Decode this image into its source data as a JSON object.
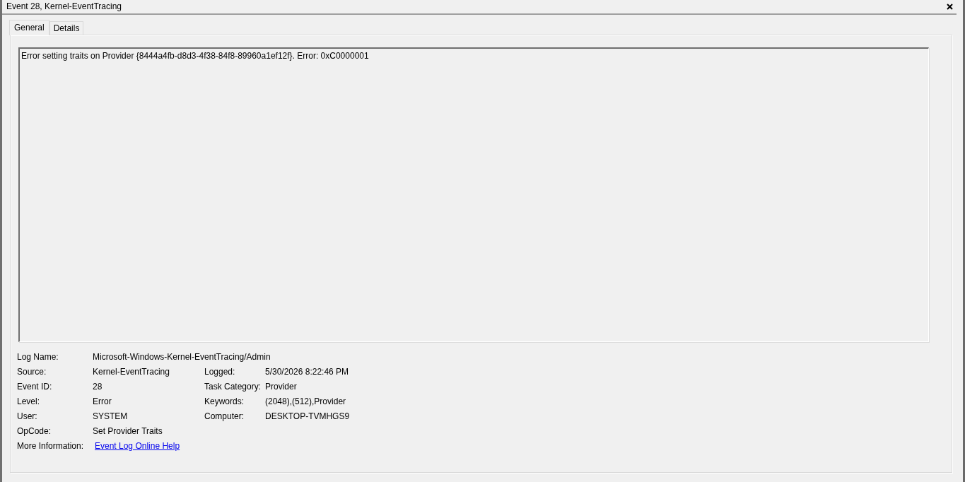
{
  "window": {
    "title": "Event 28, Kernel-EventTracing"
  },
  "tabs": [
    {
      "label": "General",
      "selected": true
    },
    {
      "label": "Details",
      "selected": false
    }
  ],
  "description": "Error setting traits on Provider {8444a4fb-d8d3-4f38-84f8-89960a1ef12f}. Error: 0xC0000001",
  "fields": [
    [
      {
        "label": "Log Name:",
        "value": "Microsoft-Windows-Kernel-EventTracing/Admin"
      }
    ],
    [
      {
        "label": "Source:",
        "value": "Kernel-EventTracing"
      },
      {
        "label": "Logged:",
        "value": "5/30/2026 8:22:46 PM"
      }
    ],
    [
      {
        "label": "Event ID:",
        "value": "28"
      },
      {
        "label": "Task Category:",
        "value": "Provider"
      }
    ],
    [
      {
        "label": "Level:",
        "value": "Error"
      },
      {
        "label": "Keywords:",
        "value": "(2048),(512),Provider"
      }
    ],
    [
      {
        "label": "User:",
        "value": "SYSTEM"
      },
      {
        "label": "Computer:",
        "value": "DESKTOP-TVMHGS9"
      }
    ],
    [
      {
        "label": "OpCode:",
        "value": "Set Provider Traits"
      }
    ],
    [
      {
        "label": "More Information:",
        "value": "Event Log Online Help",
        "kind": "link"
      }
    ]
  ]
}
